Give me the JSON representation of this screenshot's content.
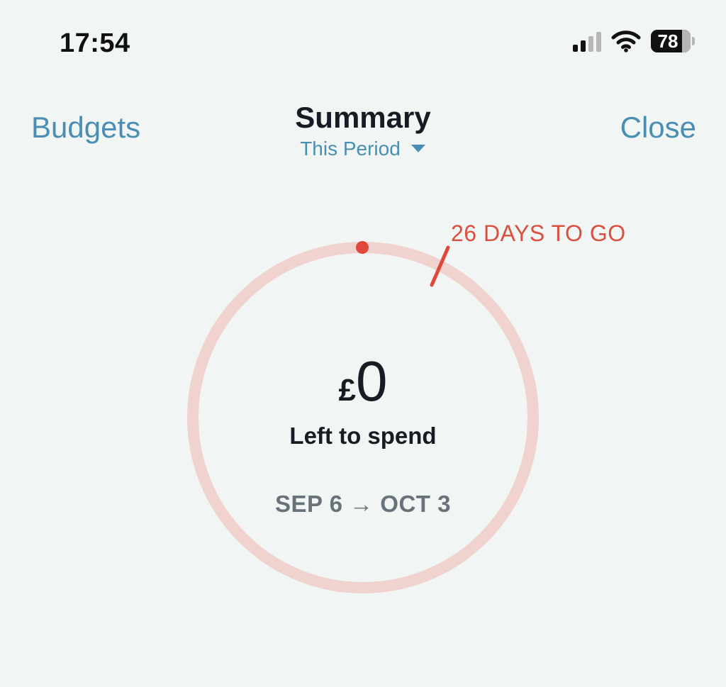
{
  "status_bar": {
    "time": "17:54",
    "battery_percent": "78",
    "icons": [
      "cellular-signal-icon",
      "wifi-icon",
      "battery-icon"
    ]
  },
  "nav": {
    "left_label": "Budgets",
    "title": "Summary",
    "subtitle": "This Period",
    "right_label": "Close"
  },
  "summary": {
    "days_to_go_label": "26 DAYS TO GO",
    "currency_symbol": "£",
    "amount": "0",
    "amount_label": "Left to spend",
    "date_range": "SEP 6 → OCT 3",
    "period_elapsed_fraction": 0.04
  },
  "colors": {
    "background": "#f1f5f3",
    "accent_blue": "#4a8fb3",
    "ring_track": "#f0d3cf",
    "accent_red": "#e0483a",
    "days_text": "#d9503f",
    "primary_text": "#151c24",
    "secondary_text": "#68727b"
  }
}
